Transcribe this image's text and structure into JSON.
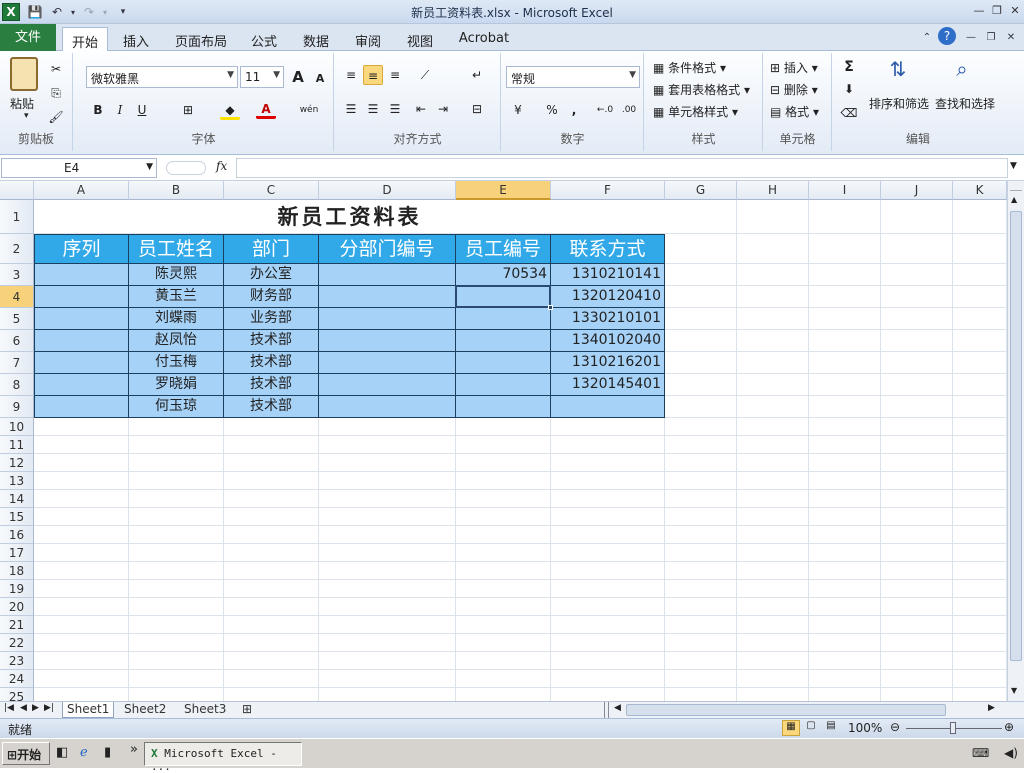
{
  "window": {
    "title": "新员工资料表.xlsx - Microsoft Excel",
    "app_icon": "X",
    "controls": [
      "—",
      "❐",
      "✕"
    ]
  },
  "quick_access": {
    "save": "💾",
    "undo": "↶",
    "redo": "↷"
  },
  "ribbon_tabs": {
    "file": "文件",
    "home": "开始",
    "insert": "插入",
    "page_layout": "页面布局",
    "formulas": "公式",
    "data": "数据",
    "review": "审阅",
    "view": "视图",
    "acrobat": "Acrobat"
  },
  "ribbon": {
    "clipboard": {
      "label": "剪贴板",
      "paste": "粘贴"
    },
    "font": {
      "label": "字体",
      "font_name": "微软雅黑",
      "font_size": "11",
      "bold": "B",
      "italic": "I",
      "underline": "U",
      "grow": "A",
      "shrink": "A",
      "color_a": "A",
      "wen": "wén"
    },
    "alignment": {
      "label": "对齐方式"
    },
    "number": {
      "label": "数字",
      "format": "常规",
      "percent": "%",
      "comma": ",",
      "inc": "←.0",
      "dec": ".00"
    },
    "styles": {
      "label": "样式",
      "conditional": "条件格式",
      "table": "套用表格格式",
      "cell_styles": "单元格样式"
    },
    "cells": {
      "label": "单元格",
      "insert": "插入",
      "delete": "删除",
      "format": "格式"
    },
    "editing": {
      "label": "编辑",
      "sum": "Σ",
      "sort_filter": "排序和筛选",
      "find_select": "查找和选择"
    }
  },
  "formula_bar": {
    "name_box": "E4",
    "fx": "fx",
    "formula": ""
  },
  "columns": [
    "A",
    "B",
    "C",
    "D",
    "E",
    "F",
    "G",
    "H",
    "I",
    "J",
    "K"
  ],
  "rows": [
    "1",
    "2",
    "3",
    "4",
    "5",
    "6",
    "7",
    "8",
    "9",
    "10",
    "11",
    "12",
    "13",
    "14",
    "15",
    "16",
    "17",
    "18",
    "19",
    "20",
    "21",
    "22",
    "23",
    "24",
    "25"
  ],
  "sheet": {
    "title": "新员工资料表",
    "headers": [
      "序列",
      "员工姓名",
      "部门",
      "分部门编号",
      "员工编号",
      "联系方式"
    ],
    "records": [
      [
        "",
        "陈灵熙",
        "办公室",
        "",
        "70534",
        "1310210141"
      ],
      [
        "",
        "黄玉兰",
        "财务部",
        "",
        "",
        "1320120410"
      ],
      [
        "",
        "刘蝶雨",
        "业务部",
        "",
        "",
        "1330210101"
      ],
      [
        "",
        "赵凤怡",
        "技术部",
        "",
        "",
        "1340102040"
      ],
      [
        "",
        "付玉梅",
        "技术部",
        "",
        "",
        "1310216201"
      ],
      [
        "",
        "罗晓娟",
        "技术部",
        "",
        "",
        "1320145401"
      ],
      [
        "",
        "何玉琼",
        "技术部",
        "",
        "",
        ""
      ]
    ],
    "active_cell": "E4"
  },
  "sheet_tabs": [
    "Sheet1",
    "Sheet2",
    "Sheet3"
  ],
  "status_bar": {
    "ready": "就绪",
    "zoom": "100%"
  },
  "taskbar": {
    "start": "开始",
    "excel_task": "Microsoft Excel - ..."
  },
  "colors": {
    "title_row_bg": "#ffffff",
    "header_bg": "#31a9e8",
    "data_bg": "#a6d2f7",
    "selection": "#2a4a73",
    "file_tab": "#2a7e3f"
  }
}
